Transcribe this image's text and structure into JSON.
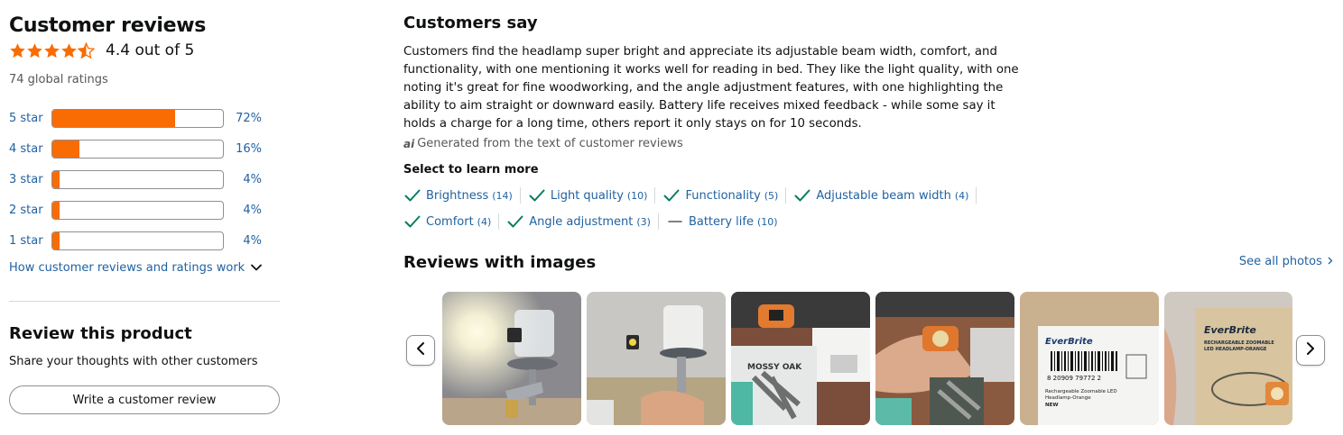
{
  "customer_reviews": {
    "title": "Customer reviews",
    "rating_text": "4.4 out of 5",
    "rating_value": 4.4,
    "global_ratings": "74 global ratings",
    "histogram": [
      {
        "label": "5 star",
        "percent": 72,
        "percent_text": "72%"
      },
      {
        "label": "4 star",
        "percent": 16,
        "percent_text": "16%"
      },
      {
        "label": "3 star",
        "percent": 4,
        "percent_text": "4%"
      },
      {
        "label": "2 star",
        "percent": 4,
        "percent_text": "4%"
      },
      {
        "label": "1 star",
        "percent": 4,
        "percent_text": "4%"
      }
    ],
    "how_link": "How customer reviews and ratings work"
  },
  "review_product": {
    "title": "Review this product",
    "subtitle": "Share your thoughts with other customers",
    "button": "Write a customer review"
  },
  "customers_say": {
    "title": "Customers say",
    "summary": "Customers find the headlamp super bright and appreciate its adjustable beam width, comfort, and functionality, with one mentioning it works well for reading in bed. They like the light quality, with one noting it's great for fine woodworking, and the angle adjustment features, with one highlighting the ability to aim straight or downward easily. Battery life receives mixed feedback - while some say it holds a charge for a long time, others report it only stays on for 10 seconds.",
    "ai_badge": "ai",
    "generated": "Generated from the text of customer reviews",
    "select_title": "Select to learn more",
    "aspects_row1": [
      {
        "label": "Brightness",
        "count": "(14)",
        "sentiment": "positive"
      },
      {
        "label": "Light quality",
        "count": "(10)",
        "sentiment": "positive"
      },
      {
        "label": "Functionality",
        "count": "(5)",
        "sentiment": "positive"
      },
      {
        "label": "Adjustable beam width",
        "count": "(4)",
        "sentiment": "positive"
      }
    ],
    "aspects_row2": [
      {
        "label": "Comfort",
        "count": "(4)",
        "sentiment": "positive"
      },
      {
        "label": "Angle adjustment",
        "count": "(3)",
        "sentiment": "positive"
      },
      {
        "label": "Battery life",
        "count": "(10)",
        "sentiment": "mixed"
      }
    ]
  },
  "reviews_images": {
    "title": "Reviews with images",
    "see_all": "See all photos",
    "thumbnails": [
      {
        "name": "photo-headlamp-glow"
      },
      {
        "name": "photo-headlamp-held"
      },
      {
        "name": "photo-mossy-oak-package"
      },
      {
        "name": "photo-headlamp-in-hand"
      },
      {
        "name": "photo-everbrite-box-label"
      },
      {
        "name": "photo-everbrite-box-front"
      }
    ],
    "box_texts": {
      "brand": "EverBrite",
      "label_line1": "Rechargeable Zoomable LED",
      "label_line2": "Headlamp-Orange",
      "label_new": "NEW",
      "barcode_digits": "8 20909 79772 2",
      "front_line1": "RECHARGEABLE ZOOMABLE",
      "front_line2": "LED HEADLAMP-ORANGE",
      "mossy": "MOSSY OAK"
    }
  },
  "colors": {
    "link": "#2162a1",
    "bar_fill": "#f96b03",
    "star": "#f96b03",
    "check": "#067d62"
  }
}
